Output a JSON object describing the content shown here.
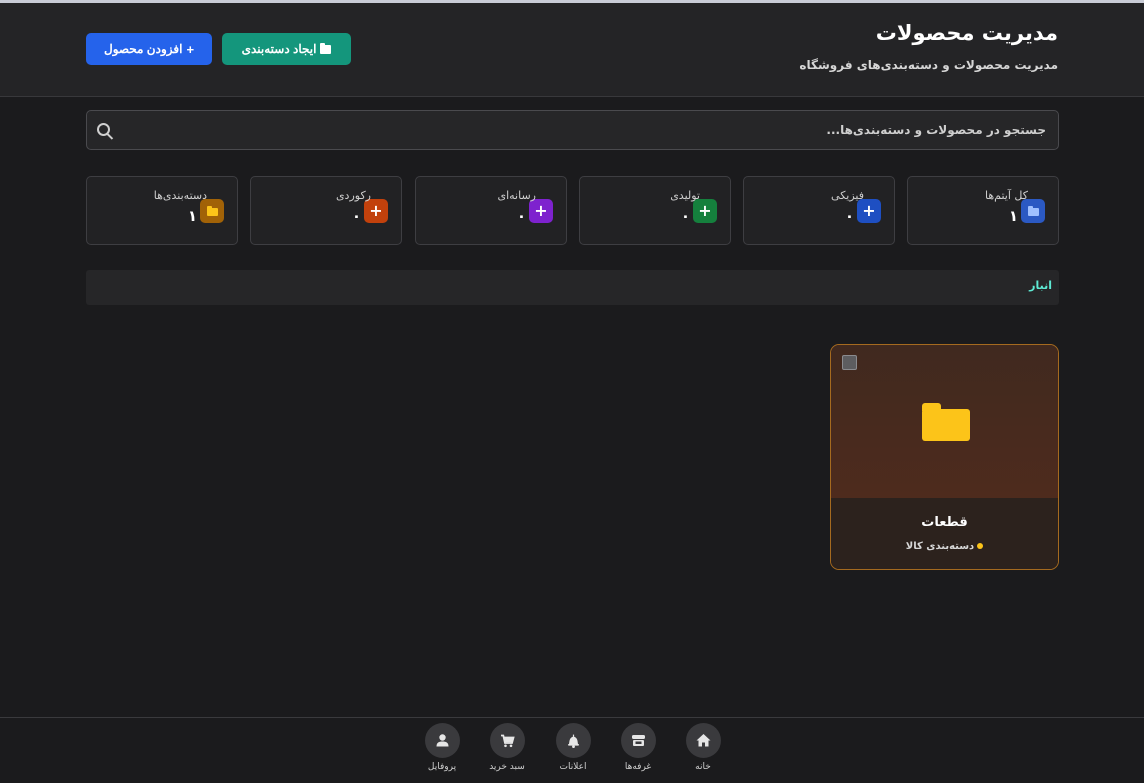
{
  "header": {
    "title": "مدیریت محصولات",
    "subtitle": "مدیریت محصولات و دسته‌بندی‌های فروشگاه",
    "create_category_label": "ایجاد دسته‌بندی",
    "add_product_label": "افزودن محصول"
  },
  "search": {
    "placeholder": "جستجو در محصولات و دسته‌بندی‌ها..."
  },
  "stats": [
    {
      "label": "کل آیتم‌ها",
      "value": "۱",
      "icon": "folder-icon",
      "color": "#2b59c3"
    },
    {
      "label": "فیزیکی",
      "value": "۰",
      "icon": "plus-icon",
      "color": "#1e4fc2"
    },
    {
      "label": "تولیدی",
      "value": "۰",
      "icon": "plus-icon",
      "color": "#15803d"
    },
    {
      "label": "رسانه‌ای",
      "value": "۰",
      "icon": "plus-icon",
      "color": "#7e22ce"
    },
    {
      "label": "رکوردی",
      "value": "۰",
      "icon": "plus-icon",
      "color": "#c2410c"
    },
    {
      "label": "دسته‌بندی‌ها",
      "value": "۱",
      "icon": "folder-icon",
      "color": "#a16207"
    }
  ],
  "breadcrumb": {
    "current": "انبار"
  },
  "category_card": {
    "name": "قطعات",
    "type": "دسته‌بندی کالا",
    "accent": "#fcc419"
  },
  "bottom_nav": [
    {
      "label": "خانه",
      "icon": "home-icon"
    },
    {
      "label": "غرفه‌ها",
      "icon": "store-icon"
    },
    {
      "label": "اعلانات",
      "icon": "bell-icon"
    },
    {
      "label": "سبد خرید",
      "icon": "cart-icon"
    },
    {
      "label": "پروفایل",
      "icon": "user-icon"
    }
  ]
}
